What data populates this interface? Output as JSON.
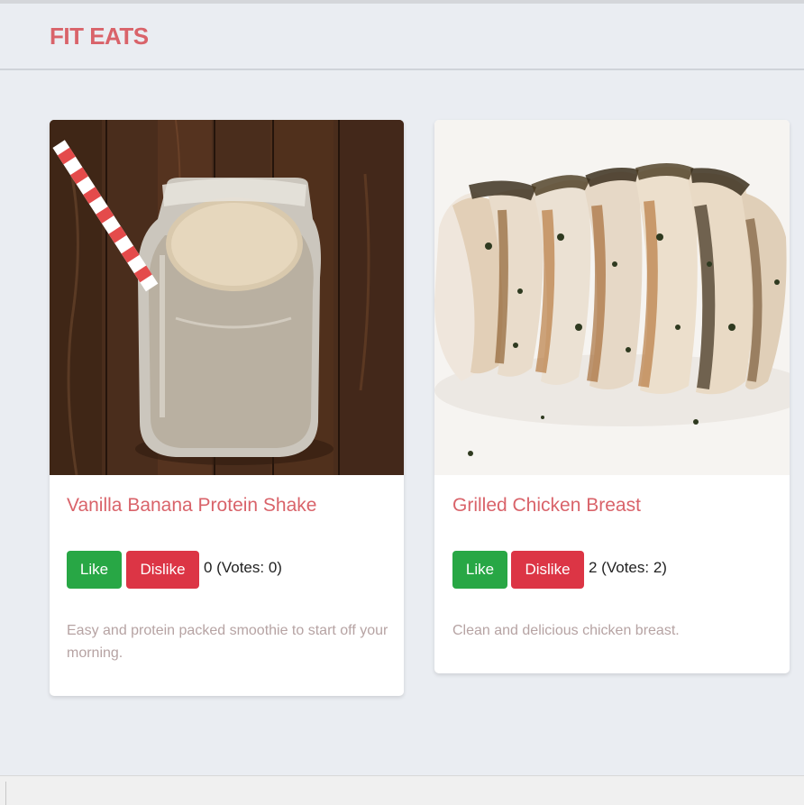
{
  "navbar": {
    "brand": "FIT EATS"
  },
  "colors": {
    "brand": "#d9636a",
    "like": "#28a745",
    "dislike": "#dc3545",
    "page_bg": "#eaedf2"
  },
  "items": [
    {
      "title": "Vanilla Banana Protein Shake",
      "like_label": "Like",
      "dislike_label": "Dislike",
      "votes_text": "0 (Votes: 0)",
      "description": "Easy and protein packed smoothie to start off your morning.",
      "image_icon": "protein-shake-jar-photo"
    },
    {
      "title": "Grilled Chicken Breast",
      "like_label": "Like",
      "dislike_label": "Dislike",
      "votes_text": "2 (Votes: 2)",
      "description": "Clean and delicious chicken breast.",
      "image_icon": "grilled-chicken-photo"
    }
  ]
}
